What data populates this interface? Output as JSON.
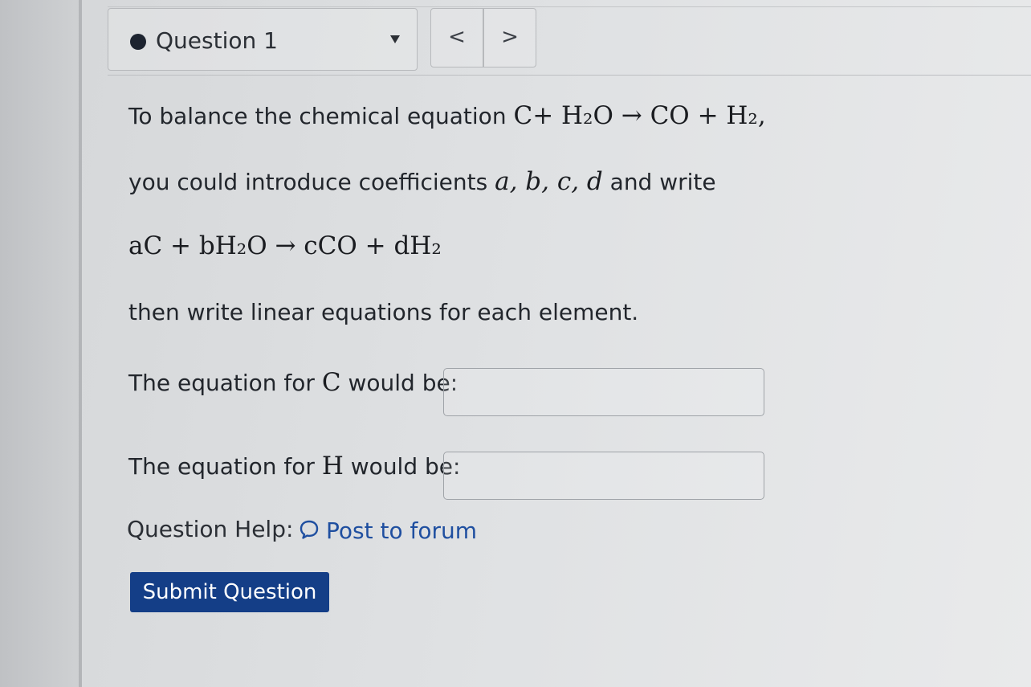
{
  "question_nav": {
    "current_question": "Question 1",
    "prev_label": "<",
    "next_label": ">"
  },
  "question": {
    "intro": "To balance the chemical equation",
    "equation_1": "C+ H₂O → CO + H₂,",
    "line2_prefix": "you could introduce coefficients",
    "coefficients": "a, b, c, d",
    "line2_suffix": "and write",
    "equation_2": "aC + bH₂O → cCO + dH₂",
    "instruction": "then write linear equations for each element.",
    "prompt_c_prefix": "The equation for",
    "prompt_c_element": "C",
    "prompt_c_suffix": "would be:",
    "prompt_h_prefix": "The equation for",
    "prompt_h_element": "H",
    "prompt_h_suffix": "would be:",
    "answer_c_value": "",
    "answer_h_value": ""
  },
  "help": {
    "label": "Question Help:",
    "forum_link": "Post to forum",
    "icon": "chat-bubble-icon"
  },
  "submit": {
    "label": "Submit Question",
    "color": "#143e87"
  }
}
